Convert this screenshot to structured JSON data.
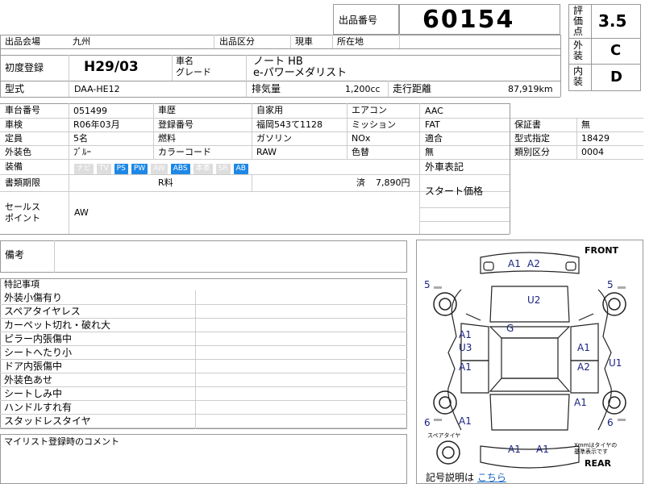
{
  "header": {
    "lot_label": "出品番号",
    "lot_number": "60154",
    "venue_label": "出品会場",
    "venue_value": "九州",
    "category_label": "出品区分",
    "category_value": "現車",
    "location_label": "所在地",
    "location_value": ""
  },
  "ratings": {
    "score_label": "評価点",
    "score_value": "3.5",
    "exterior_label": "外装",
    "exterior_value": "C",
    "interior_label": "内装",
    "interior_value": "D"
  },
  "vehicle": {
    "reg_label": "初度登録",
    "reg_value": "H29/03",
    "name_label": "車名",
    "grade_label": "グレード",
    "name_value": "ノート HB",
    "grade_value": "e-パワーメダリスト",
    "model_label": "型式",
    "model_value": "DAA-HE12",
    "displacement_label": "排気量",
    "displacement_value": "1,200cc",
    "mileage_label": "走行距離",
    "mileage_value": "87,919km"
  },
  "details": {
    "chassis_label": "車台番号",
    "chassis_value": "051499",
    "history_label": "車歴",
    "history_value": "自家用",
    "ac_label": "エアコン",
    "ac_value": "AAC",
    "inspection_label": "車検",
    "inspection_value": "R06年03月",
    "plate_label": "登録番号",
    "plate_value": "福岡543て1128",
    "transmission_label": "ミッション",
    "transmission_value": "FAT",
    "warranty_label": "保証書",
    "warranty_value": "無",
    "capacity_label": "定員",
    "capacity_value": "5名",
    "fuel_label": "燃料",
    "fuel_value": "ガソリン",
    "nox_label": "NOx",
    "nox_value": "適合",
    "type_designation_label": "型式指定",
    "type_designation_value": "18429",
    "color_label": "外装色",
    "color_value": "ﾌﾞﾙｰ",
    "color_code_label": "カラーコード",
    "color_code_value": "RAW",
    "repaint_label": "色替",
    "repaint_value": "無",
    "class_label": "類別区分",
    "class_value": "0004",
    "equipment_label": "装備",
    "equipment": [
      {
        "name": "ナビ",
        "on": false
      },
      {
        "name": "TV",
        "on": false
      },
      {
        "name": "PS",
        "on": true
      },
      {
        "name": "PW",
        "on": true
      },
      {
        "name": "AW",
        "on": false
      },
      {
        "name": "ABS",
        "on": true
      },
      {
        "name": "本革",
        "on": false
      },
      {
        "name": "SR",
        "on": false
      },
      {
        "name": "AB",
        "on": true
      }
    ],
    "documents_label": "書類期限",
    "r_fee_label": "R料",
    "r_fee_status": "済",
    "r_fee_value": "7,890円",
    "foreign_label": "外車表記",
    "start_price_label": "スタート価格",
    "sales_point_label": "セールス\nポイント",
    "sales_point_value": "AW"
  },
  "remarks": {
    "label": "備考",
    "special_label": "特記事項",
    "special_items": [
      "外装小傷有り",
      "スペアタイヤレス",
      "カーペット切れ・破れ大",
      "ピラー内張傷中",
      "シートへたり小",
      "ドア内張傷中",
      "外装色あせ",
      "シートしみ中",
      "ハンドルすれ有",
      "スタッドレスタイヤ"
    ],
    "comment_label": "マイリスト登録時のコメント"
  },
  "diagram": {
    "front_label": "FRONT",
    "rear_label": "REAR",
    "spare_label": "スペアタイヤ",
    "note_label": "Xmmはタイヤの\n基準表示です",
    "legend_text": "記号説明は",
    "legend_link": "こちら",
    "annotations": {
      "front_bumper": [
        "A1",
        "A2"
      ],
      "hood": "U2",
      "roof": "G",
      "left_front_door": [
        "A1",
        "U3"
      ],
      "left_rear_door": "A1",
      "right_front_door": "A1",
      "right_rear_door": "A2",
      "right_side": "U1",
      "left_rear_quarter": "A1",
      "right_rear_quarter": "A1",
      "rear_bumper": [
        "A1",
        "A1"
      ],
      "tire_fl": "5",
      "tire_fr": "5",
      "tire_rl": "6",
      "tire_rr": "6"
    }
  }
}
